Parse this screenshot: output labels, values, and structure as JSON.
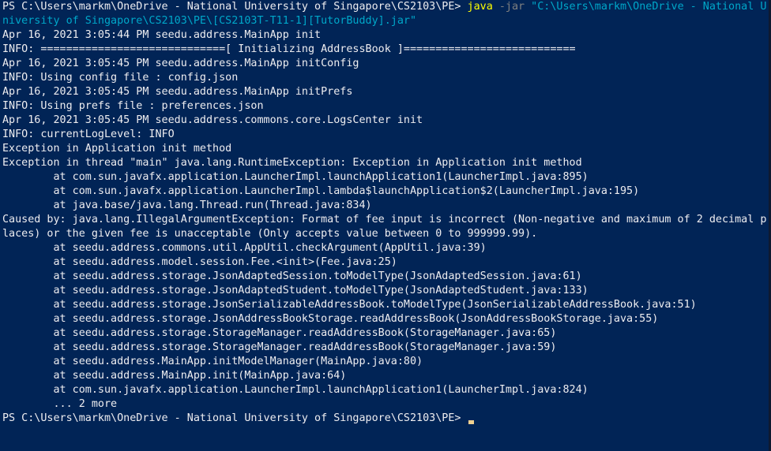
{
  "terminal": {
    "prompt": "PS C:\\Users\\markm\\OneDrive - National University of Singapore\\CS2103\\PE> ",
    "command": {
      "exe": "java",
      "flag": " -jar ",
      "arg_line1": "\"C:\\Users\\markm\\OneDrive - National U",
      "arg_line2": "niversity of Singapore\\CS2103\\PE\\[CS2103T-T11-1][TutorBuddy].jar\""
    },
    "output_lines": [
      "Apr 16, 2021 3:05:44 PM seedu.address.MainApp init",
      "INFO: =============================[ Initializing AddressBook ]===========================",
      "Apr 16, 2021 3:05:45 PM seedu.address.MainApp initConfig",
      "INFO: Using config file : config.json",
      "Apr 16, 2021 3:05:45 PM seedu.address.MainApp initPrefs",
      "INFO: Using prefs file : preferences.json",
      "Apr 16, 2021 3:05:45 PM seedu.address.commons.core.LogsCenter init",
      "INFO: currentLogLevel: INFO",
      "Exception in Application init method",
      "Exception in thread \"main\" java.lang.RuntimeException: Exception in Application init method",
      "        at com.sun.javafx.application.LauncherImpl.launchApplication1(LauncherImpl.java:895)",
      "        at com.sun.javafx.application.LauncherImpl.lambda$launchApplication$2(LauncherImpl.java:195)",
      "        at java.base/java.lang.Thread.run(Thread.java:834)",
      "Caused by: java.lang.IllegalArgumentException: Format of fee input is incorrect (Non-negative and maximum of 2 decimal p",
      "laces) or the given fee is unacceptable (Only accepts value between 0 to 999999.99).",
      "        at seedu.address.commons.util.AppUtil.checkArgument(AppUtil.java:39)",
      "        at seedu.address.model.session.Fee.<init>(Fee.java:25)",
      "        at seedu.address.storage.JsonAdaptedSession.toModelType(JsonAdaptedSession.java:61)",
      "        at seedu.address.storage.JsonAdaptedStudent.toModelType(JsonAdaptedStudent.java:133)",
      "        at seedu.address.storage.JsonSerializableAddressBook.toModelType(JsonSerializableAddressBook.java:51)",
      "        at seedu.address.storage.JsonAddressBookStorage.readAddressBook(JsonAddressBookStorage.java:55)",
      "        at seedu.address.storage.StorageManager.readAddressBook(StorageManager.java:65)",
      "        at seedu.address.storage.StorageManager.readAddressBook(StorageManager.java:59)",
      "        at seedu.address.MainApp.initModelManager(MainApp.java:80)",
      "        at seedu.address.MainApp.init(MainApp.java:64)",
      "        at com.sun.javafx.application.LauncherImpl.launchApplication1(LauncherImpl.java:824)",
      "        ... 2 more"
    ],
    "final_prompt": "PS C:\\Users\\markm\\OneDrive - National University of Singapore\\CS2103\\PE> "
  },
  "colors": {
    "background": "#012456",
    "foreground": "#eeedf0",
    "exe": "#ffff00",
    "flag": "#808080",
    "string": "#00a7c9",
    "cursor": "#f0d090"
  }
}
